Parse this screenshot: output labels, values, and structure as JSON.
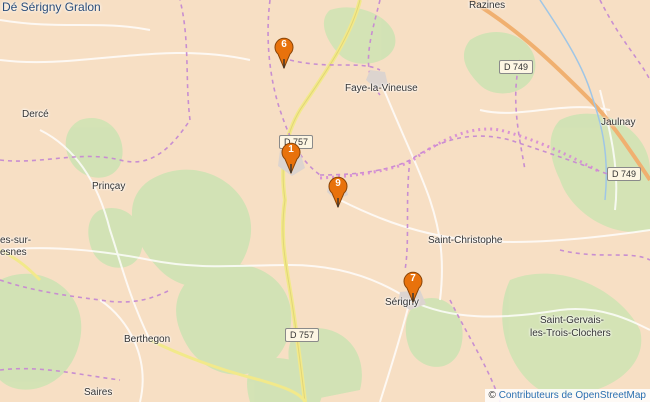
{
  "title": "Dé Sérigny Gralon",
  "places": [
    {
      "id": "razines",
      "label": "Razines"
    },
    {
      "id": "faye",
      "label": "Faye-la-Vineuse"
    },
    {
      "id": "derce",
      "label": "Dercé"
    },
    {
      "id": "jaulnay",
      "label": "Jaulnay"
    },
    {
      "id": "princay",
      "label": "Prinçay"
    },
    {
      "id": "saint-christophe",
      "label": "Saint-Christophe"
    },
    {
      "id": "serigny",
      "label": "Sérigny"
    },
    {
      "id": "saint-gervais-1",
      "label": "Saint-Gervais-"
    },
    {
      "id": "saint-gervais-2",
      "label": "les-Trois-Clochers"
    },
    {
      "id": "berthegon",
      "label": "Berthegon"
    },
    {
      "id": "saires",
      "label": "Saires"
    },
    {
      "id": "es-sur",
      "label": "es-sur-"
    },
    {
      "id": "esnes",
      "label": "esnes"
    }
  ],
  "roads": {
    "d749_north": "D 749",
    "d749_east": "D 749",
    "d757_north": "D 757",
    "d757_south": "D 757"
  },
  "markers": [
    {
      "label": "6"
    },
    {
      "label": "1"
    },
    {
      "label": "9"
    },
    {
      "label": "7"
    }
  ],
  "marker_color": "#e8720c",
  "attribution": {
    "symbol": "©",
    "link_text": "Contributeurs de OpenStreetMap"
  }
}
